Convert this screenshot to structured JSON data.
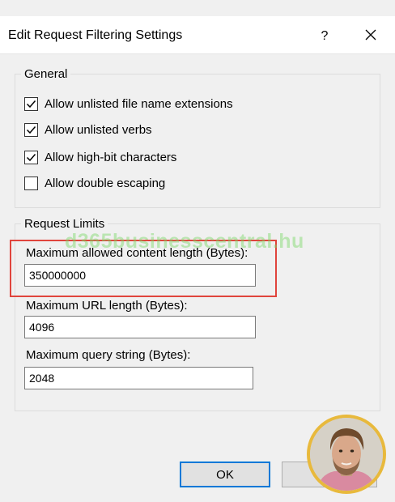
{
  "window": {
    "title": "Edit Request Filtering Settings",
    "help_label": "?",
    "close_icon": "close-icon"
  },
  "general": {
    "legend": "General",
    "options": [
      {
        "label": "Allow unlisted file name extensions",
        "checked": true
      },
      {
        "label": "Allow unlisted verbs",
        "checked": true
      },
      {
        "label": "Allow high-bit characters",
        "checked": true
      },
      {
        "label": "Allow double escaping",
        "checked": false
      }
    ]
  },
  "request_limits": {
    "legend": "Request Limits",
    "max_content_length": {
      "label": "Maximum allowed content length (Bytes):",
      "value": "350000000"
    },
    "max_url_length": {
      "label": "Maximum URL length (Bytes):",
      "value": "4096"
    },
    "max_query_string": {
      "label": "Maximum query string (Bytes):",
      "value": "2048"
    }
  },
  "buttons": {
    "ok": "OK",
    "cancel": ""
  },
  "overlay": {
    "watermark": "d365businesscentral.hu",
    "highlight_color": "#e0443c",
    "avatar_ring_color": "#e8b93c"
  }
}
